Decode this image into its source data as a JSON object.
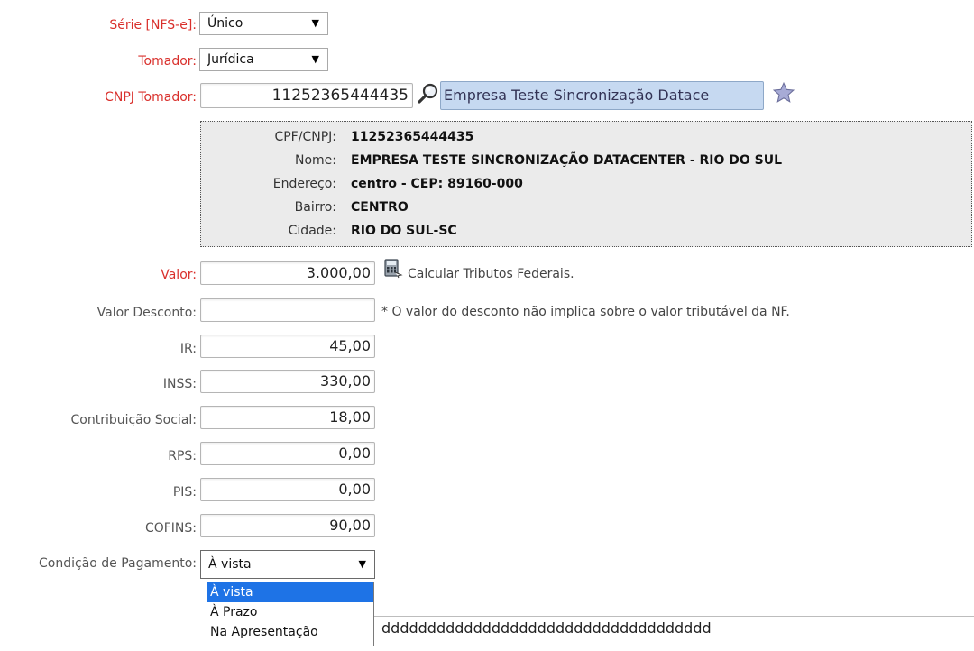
{
  "serie": {
    "label": "Série [NFS-e]:",
    "value": "Único"
  },
  "tomador": {
    "label": "Tomador:",
    "value": "Jurídica"
  },
  "cnpj": {
    "label": "CNPJ Tomador:",
    "value": "11252365444435",
    "company_button": "Empresa Teste Sincronização Datace"
  },
  "info": {
    "rows": [
      {
        "key": "CPF/CNPJ:",
        "value": "11252365444435"
      },
      {
        "key": "Nome:",
        "value": "EMPRESA TESTE SINCRONIZAÇÃO DATACENTER - RIO DO SUL"
      },
      {
        "key": "Endereço:",
        "value": "centro - CEP: 89160-000"
      },
      {
        "key": "Bairro:",
        "value": "CENTRO"
      },
      {
        "key": "Cidade:",
        "value": "RIO DO SUL-SC"
      }
    ]
  },
  "valor": {
    "label": "Valor:",
    "value": "3.000,00",
    "calc_link": "Calcular Tributos Federais."
  },
  "desconto": {
    "label": "Valor Desconto:",
    "value": "",
    "note": "* O valor do desconto não implica sobre o valor tributável da NF."
  },
  "taxes": [
    {
      "label": "IR:",
      "value": "45,00"
    },
    {
      "label": "INSS:",
      "value": "330,00"
    },
    {
      "label": "Contribuição Social:",
      "value": "18,00"
    },
    {
      "label": "RPS:",
      "value": "0,00"
    },
    {
      "label": "PIS:",
      "value": "0,00"
    },
    {
      "label": "COFINS:",
      "value": "90,00"
    }
  ],
  "pagamento": {
    "label": "Condição de Pagamento:",
    "value": "À vista",
    "options": [
      "À vista",
      "À Prazo",
      "Na Apresentação"
    ]
  },
  "description_text": "dddddddddddddddddddddddddddddddddddd",
  "colors": {
    "required_label": "#d9302c",
    "panel_bg": "#ebebeb",
    "button_bg": "#c6d9f1",
    "highlight": "#1e73e6"
  }
}
